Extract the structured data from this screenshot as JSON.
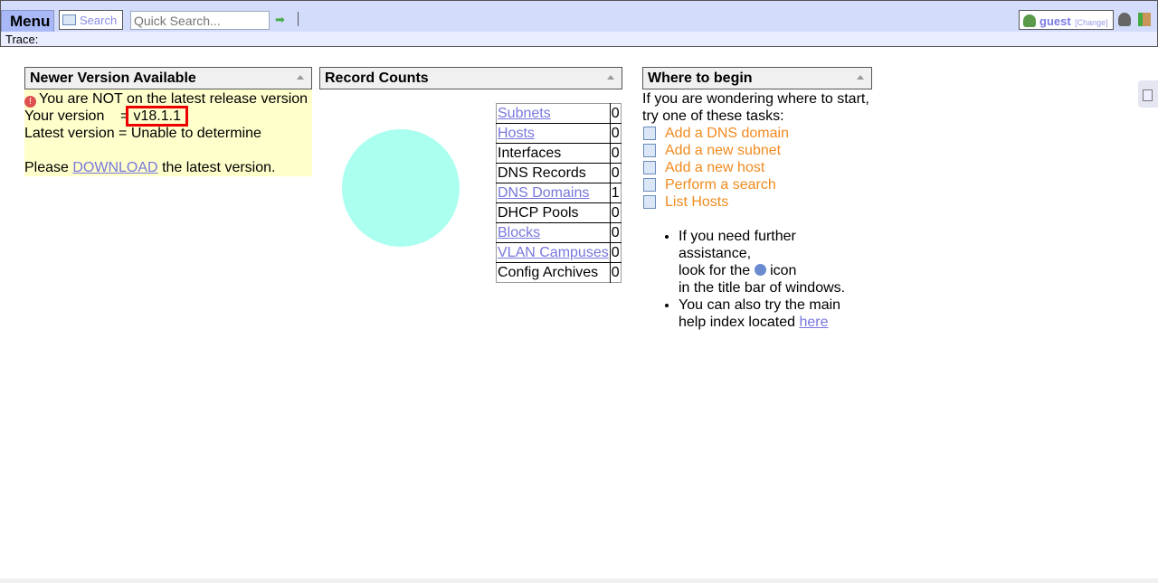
{
  "topbar": {
    "menu": "Menu",
    "search": "Search",
    "quick_search_placeholder": "Quick Search...",
    "user": "guest",
    "change": "[Change]"
  },
  "trace": {
    "label": "Trace:"
  },
  "newer_version": {
    "title": "Newer Version Available",
    "warning": "You are NOT on the latest release version",
    "your_label": "Your version",
    "your_eq": "=",
    "your_value": "v18.1.1",
    "latest": "Latest version = Unable to determine",
    "please": "Please",
    "download": "DOWNLOAD",
    "after": "the latest version."
  },
  "record_counts": {
    "title": "Record Counts",
    "rows": [
      {
        "label": "Subnets",
        "value": "0",
        "link": true
      },
      {
        "label": "Hosts",
        "value": "0",
        "link": true
      },
      {
        "label": "Interfaces",
        "value": "0",
        "link": false
      },
      {
        "label": "DNS Records",
        "value": "0",
        "link": false
      },
      {
        "label": "DNS Domains",
        "value": "1",
        "link": true
      },
      {
        "label": "DHCP Pools",
        "value": "0",
        "link": false
      },
      {
        "label": "Blocks",
        "value": "0",
        "link": true
      },
      {
        "label": "VLAN Campuses",
        "value": "0",
        "link": true
      },
      {
        "label": "Config Archives",
        "value": "0",
        "link": false
      }
    ],
    "pie_color": "#aaffee"
  },
  "where_to_begin": {
    "title": "Where to begin",
    "intro1": "If you are wondering where to start,",
    "intro2": "try one of these tasks:",
    "tasks": [
      "Add a DNS domain",
      "Add a new subnet",
      "Add a new host",
      "Perform a search",
      "List Hosts"
    ],
    "b1a": "If you need further assistance,",
    "b1b": "look for the",
    "b1c": "icon",
    "b1d": "in the title bar of windows.",
    "b2a": "You can also try the main",
    "b2b": "help index located",
    "b2c": "here"
  }
}
